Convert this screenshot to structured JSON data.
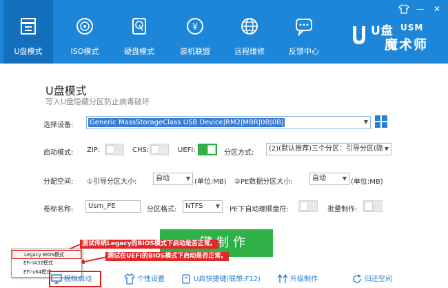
{
  "window": {
    "skin_icon": "shirt-icon",
    "minimize": "—",
    "close": "✕"
  },
  "nav": {
    "tabs": [
      {
        "label": "U盘模式",
        "icon": "usb-drive-icon",
        "active": true
      },
      {
        "label": "ISO模式",
        "icon": "disc-icon",
        "active": false
      },
      {
        "label": "硬盘模式",
        "icon": "hard-disk-icon",
        "active": false
      },
      {
        "label": "装机联盟",
        "icon": "yen-coin-icon",
        "active": false
      },
      {
        "label": "远程维修",
        "icon": "globe-icon",
        "active": false
      },
      {
        "label": "反馈中心",
        "icon": "chat-bubble-icon",
        "active": false
      }
    ]
  },
  "logo": {
    "part1": "U盘",
    "part2": "USM",
    "part3": "魔术师"
  },
  "page": {
    "title": "U盘模式",
    "subtitle": "写入U盘隐藏分区防止病毒破坏"
  },
  "device": {
    "label": "选择设备:",
    "value": "Generic MassStorageClass USB Device|RM2|MBR|0B|0B|"
  },
  "boot": {
    "label": "启动模式:",
    "zip_label": "ZIP:",
    "zip_on": false,
    "chs_label": "CHS:",
    "chs_on": false,
    "uefi_label": "UEFI:",
    "uefi_on": true,
    "partition_label": "分区方式:",
    "partition_value": "(2)(默认推荐)三个分区：引导分区(隐"
  },
  "alloc": {
    "label": "分配空间:",
    "boot_size_label": "①引导分区大小:",
    "boot_size_value": "自动",
    "unit1": "(单位:MB)",
    "pe_size_label": "②PE数据分区大小:",
    "pe_size_value": "自动",
    "unit2": "(单位:MB)"
  },
  "volume": {
    "label": "卷标名称:",
    "value": "Usm_PE",
    "fs_label": "分区格式:",
    "fs_value": "NTFS",
    "auto_label": "PE下自动理顺盘符:",
    "auto_on": false,
    "batch_label": "批量制作:",
    "batch_on": false
  },
  "make_button": "一键制作",
  "popup": {
    "items": [
      "Legacy BIOS模式",
      "EFI-IA32模式",
      "EFI-x64模式"
    ],
    "highlighted": "Legacy BIOS模式"
  },
  "annotations": {
    "legacy": "测试传统Legacy的BIOS模式下启动是否正常。",
    "uefi": "测试在UEFI的BIOS模式下启动是否正常。",
    "color": "#e22727"
  },
  "bottom": {
    "items": [
      {
        "label": "模拟启动",
        "icon": "monitor-icon"
      },
      {
        "label": "个性设置",
        "icon": "shirt-icon"
      },
      {
        "label": "U启快捷键(联想:F12)",
        "icon": "key-icon"
      },
      {
        "label": "升级制作",
        "icon": "upgrade-arrows-icon"
      },
      {
        "label": "归还空间",
        "icon": "refresh-icon"
      }
    ]
  },
  "colors": {
    "header": "#1e86d9",
    "active_tab": "#1470bd",
    "accent_green": "#2fb148",
    "link_blue": "#2a7fd0"
  }
}
